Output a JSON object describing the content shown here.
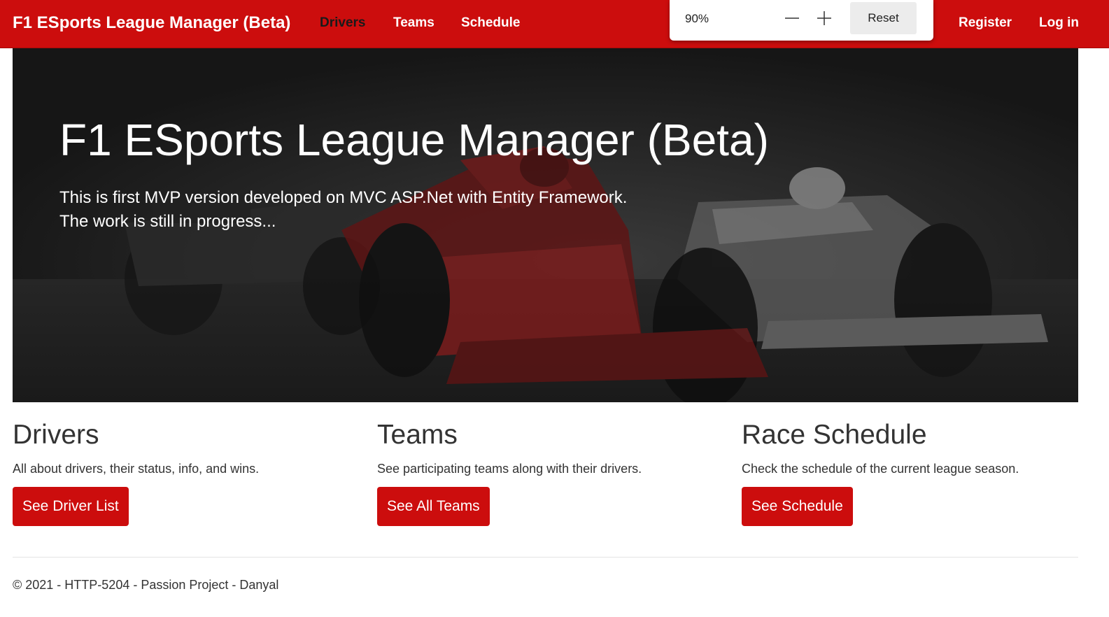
{
  "navbar": {
    "brand": "F1 ESports League Manager (Beta)",
    "links": {
      "drivers": "Drivers",
      "teams": "Teams",
      "schedule": "Schedule",
      "register": "Register",
      "login": "Log in"
    },
    "active": "drivers",
    "color": "#cc0d0d"
  },
  "zoom": {
    "value": "90%",
    "reset_label": "Reset",
    "zoom_out_icon": "minus-icon",
    "zoom_in_icon": "plus-icon"
  },
  "hero": {
    "title": "F1 ESports League Manager (Beta)",
    "line1": "This is first MVP version developed on MVC ASP.Net with Entity Framework.",
    "line2": "The work is still in progress...",
    "background": "dark photo of formula one race cars"
  },
  "sections": {
    "drivers": {
      "heading": "Drivers",
      "text": "All about drivers, their status, info, and wins.",
      "button": "See Driver List"
    },
    "teams": {
      "heading": "Teams",
      "text": "See participating teams along with their drivers.",
      "button": "See All Teams"
    },
    "schedule": {
      "heading": "Race Schedule",
      "text": "Check the schedule of the current league season.",
      "button": "See Schedule"
    }
  },
  "footer": {
    "text": "© 2021 - HTTP-5204 - Passion Project - Danyal"
  }
}
